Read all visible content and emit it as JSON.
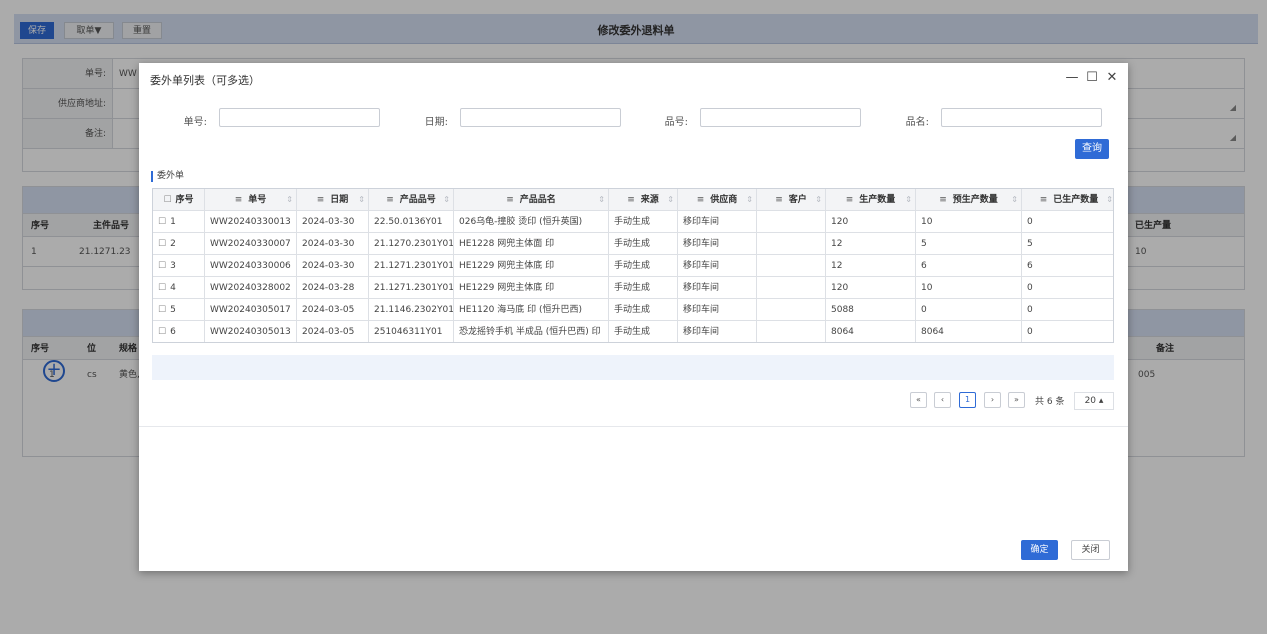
{
  "background": {
    "toolbar": {
      "save": "保存",
      "cancel": "取单▼",
      "reset": "重置"
    },
    "title": "修改委外退料单",
    "form": {
      "order_no_label": "单号:",
      "order_no_value": "WW",
      "address_label": "供应商地址:",
      "remark_label": "备注:"
    },
    "section1": {
      "headers": [
        "序号",
        "主件品号",
        "已生产量"
      ],
      "row": [
        "1",
        "21.1271.23",
        "10"
      ]
    },
    "section2": {
      "headers": [
        "序号",
        "位",
        "规格",
        "备注"
      ],
      "row": [
        "1",
        "cs",
        "黄色,",
        "005"
      ]
    }
  },
  "dialog": {
    "title": "委外单列表（可多选）",
    "controls": {
      "minimize": "—",
      "maximize": "☐",
      "close": "✕"
    },
    "search": {
      "order_no": "单号:",
      "date": "日期:",
      "product_no": "品号:",
      "product_name": "品名:",
      "query": "查询"
    },
    "grid_title": "委外单",
    "columns": [
      "序号",
      "单号",
      "日期",
      "产品品号",
      "产品品名",
      "来源",
      "供应商",
      "客户",
      "生产数量",
      "预生产数量",
      "已生产数量"
    ],
    "rows": [
      [
        "1",
        "WW20240330013",
        "2024-03-30",
        "22.50.0136Y01",
        "026乌龟-撞胶 烫印 (恒升英国)",
        "手动生成",
        "移印车间",
        "",
        "120",
        "10",
        "0"
      ],
      [
        "2",
        "WW20240330007",
        "2024-03-30",
        "21.1270.2301Y01",
        "HE1228 网兜主体面 印",
        "手动生成",
        "移印车间",
        "",
        "12",
        "5",
        "5"
      ],
      [
        "3",
        "WW20240330006",
        "2024-03-30",
        "21.1271.2301Y01",
        "HE1229 网兜主体底 印",
        "手动生成",
        "移印车间",
        "",
        "12",
        "6",
        "6"
      ],
      [
        "4",
        "WW20240328002",
        "2024-03-28",
        "21.1271.2301Y01",
        "HE1229 网兜主体底 印",
        "手动生成",
        "移印车间",
        "",
        "120",
        "10",
        "0"
      ],
      [
        "5",
        "WW20240305017",
        "2024-03-05",
        "21.1146.2302Y01",
        "HE1120 海马底 印 (恒升巴西)",
        "手动生成",
        "移印车间",
        "",
        "5088",
        "0",
        "0"
      ],
      [
        "6",
        "WW20240305013",
        "2024-03-05",
        "251046311Y01",
        "恐龙摇铃手机 半成品 (恒升巴西) 印",
        "手动生成",
        "移印车间",
        "",
        "8064",
        "8064",
        "0"
      ]
    ],
    "pager": {
      "first": "«",
      "prev": "‹",
      "page": "1",
      "next": "›",
      "last": "»",
      "total": "共 6 条",
      "size": "20 ▴"
    },
    "ok": "确定",
    "close_btn": "关闭",
    "colors": {
      "accent": "#2f6bd6"
    }
  }
}
